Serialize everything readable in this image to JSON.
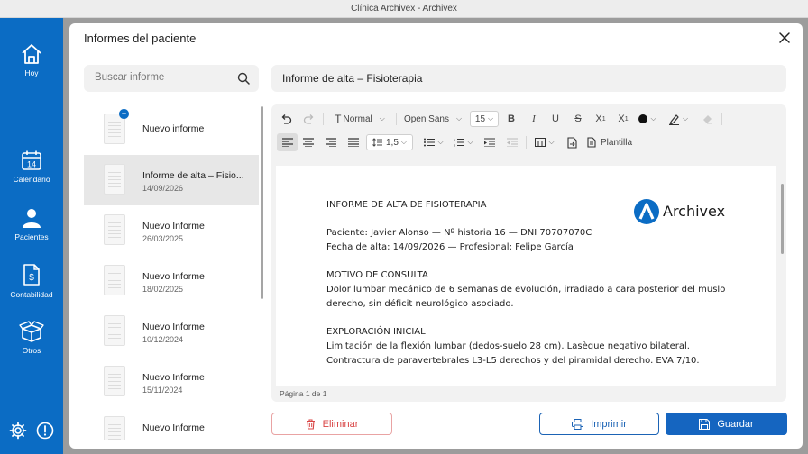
{
  "window": {
    "title": "Clínica Archivex - Archivex"
  },
  "sidebar": {
    "items": [
      {
        "label": "Hoy",
        "icon": "home-icon"
      },
      {
        "label": "Calendario",
        "icon": "calendar-icon",
        "day": "14"
      },
      {
        "label": "Pacientes",
        "icon": "person-icon"
      },
      {
        "label": "Contabilidad",
        "icon": "invoice-icon"
      },
      {
        "label": "Otros",
        "icon": "box-icon"
      }
    ],
    "bottom_icons": [
      "gear-icon",
      "info-icon"
    ]
  },
  "modal": {
    "title": "Informes del paciente",
    "search": {
      "placeholder": "Buscar informe"
    },
    "reports": [
      {
        "name": "Nuevo informe",
        "date": "",
        "is_new": true
      },
      {
        "name": "Informe de alta – Fisio...",
        "date": "14/09/2026",
        "selected": true
      },
      {
        "name": "Nuevo Informe",
        "date": "26/03/2025"
      },
      {
        "name": "Nuevo Informe",
        "date": "18/02/2025"
      },
      {
        "name": "Nuevo Informe",
        "date": "10/12/2024"
      },
      {
        "name": "Nuevo Informe",
        "date": "15/11/2024"
      },
      {
        "name": "Nuevo Informe",
        "date": ""
      }
    ],
    "document_title": "Informe de alta – Fisioterapia",
    "toolbar": {
      "style": "Normal",
      "font": "Open Sans",
      "size": "15",
      "line_spacing": "1,5",
      "template_label": "Plantilla"
    },
    "document": {
      "logo_text": "Archivex",
      "lines": [
        "INFORME DE ALTA DE FISIOTERAPIA",
        "",
        "Paciente: Javier Alonso — Nº historia 16 — DNI 70707070C",
        "Fecha de alta: 14/09/2026 — Profesional: Felipe García",
        "",
        "MOTIVO DE CONSULTA",
        "Dolor lumbar mecánico de 6 semanas de evolución, irradiado a cara posterior del muslo",
        "derecho, sin déficit neurológico asociado.",
        "",
        "EXPLORACIÓN INICIAL",
        "Limitación de la flexión lumbar (dedos-suelo 28 cm). Lasègue negativo bilateral.",
        "Contractura de paravertebrales L3-L5 derechos y del piramidal derecho. EVA 7/10."
      ]
    },
    "status": "Página 1 de 1",
    "buttons": {
      "delete": "Eliminar",
      "print": "Imprimir",
      "save": "Guardar"
    }
  },
  "colors": {
    "brand": "#0b6cc4",
    "primary_button": "#1565c0",
    "danger": "#d94545"
  }
}
